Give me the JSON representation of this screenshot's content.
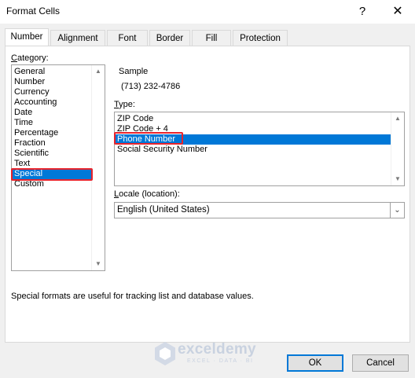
{
  "window": {
    "title": "Format Cells",
    "help_glyph": "?",
    "close_glyph": "✕"
  },
  "tabs": [
    {
      "label": "Number",
      "active": true
    },
    {
      "label": "Alignment"
    },
    {
      "label": "Font"
    },
    {
      "label": "Border"
    },
    {
      "label": "Fill"
    },
    {
      "label": "Protection"
    }
  ],
  "category": {
    "label_prefix": "C",
    "label_rest": "ategory:",
    "items": [
      "General",
      "Number",
      "Currency",
      "Accounting",
      "Date",
      "Time",
      "Percentage",
      "Fraction",
      "Scientific",
      "Text",
      "Special",
      "Custom"
    ],
    "selected": "Special"
  },
  "sample": {
    "label": "Sample",
    "value": "(713) 232-4786"
  },
  "type": {
    "label_prefix": "T",
    "label_rest": "ype:",
    "items": [
      "ZIP Code",
      "ZIP Code + 4",
      "Phone Number",
      "Social Security Number"
    ],
    "selected": "Phone Number"
  },
  "locale": {
    "label_prefix": "L",
    "label_rest": "ocale (location):",
    "value": "English (United States)"
  },
  "description": "Special formats are useful for tracking list and database values.",
  "buttons": {
    "ok": "OK",
    "cancel": "Cancel"
  },
  "watermark": {
    "name": "exceldemy",
    "tagline": "EXCEL · DATA · BI"
  },
  "colors": {
    "selection": "#0078d7",
    "highlight_box": "#e8232b",
    "default_button_border": "#0078d7"
  }
}
